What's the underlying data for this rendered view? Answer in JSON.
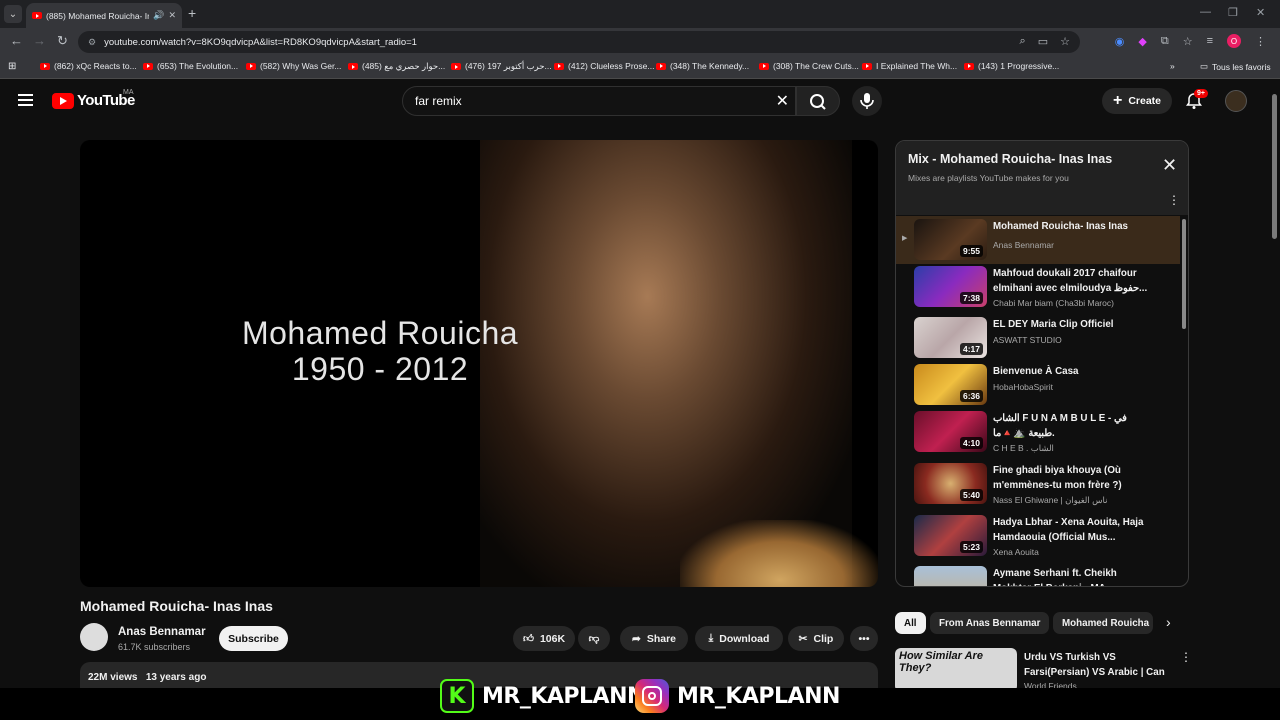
{
  "browser": {
    "tab_title": "(885) Mohamed Rouicha- In",
    "url": "youtube.com/watch?v=8KO9qdvicpA&list=RD8KO9qdvicpA&start_radio=1",
    "profile_initial": "O",
    "bookmarks": [
      "(862) xQc Reacts to...",
      "(653) The Evolution...",
      "(582) Why Was Ger...",
      "(485) حوار حصري مع...",
      "(476) حرب أكتوبر 197...",
      "(412) Clueless Prose...",
      "(348) The Kennedy...",
      "(308) The Crew Cuts...",
      "I Explained The Wh...",
      "(143) 1 Progressive..."
    ],
    "all_bookmarks": "Tous les favoris"
  },
  "youtube": {
    "logo": "YouTube",
    "country": "MA",
    "search_value": "far remix",
    "create_label": "Create",
    "notif_badge": "9+"
  },
  "video": {
    "overlay_line1": "Mohamed Rouicha",
    "overlay_line2": "1950 - 2012",
    "title": "Mohamed Rouicha- Inas Inas",
    "channel": "Anas Bennamar",
    "subscribers": "61.7K subscribers",
    "subscribe_label": "Subscribe",
    "likes": "106K",
    "share_label": "Share",
    "download_label": "Download",
    "clip_label": "Clip",
    "views": "22M views",
    "age": "13 years ago"
  },
  "playlist": {
    "title": "Mix - Mohamed Rouicha- Inas Inas",
    "subtitle": "Mixes are playlists YouTube makes for you",
    "items": [
      {
        "title": "Mohamed Rouicha- Inas Inas",
        "channel": "Anas Bennamar",
        "duration": "9:55"
      },
      {
        "title": "Mahfoud doukali 2017 chaifour elmihani avec elmiloudya حفوظ...",
        "channel": "Chabi Mar biam (Cha3bi Maroc)",
        "duration": "7:38"
      },
      {
        "title": "EL DEY Maria Clip Officiel",
        "channel": "ASWATT STUDIO",
        "duration": "4:17"
      },
      {
        "title": "Bienvenue À Casa",
        "channel": "HobaHobaSpirit",
        "duration": "6:36"
      },
      {
        "title": "الشاب F U N A M B U L E - في طبيعة ⛰️🔺ما.",
        "channel": "C H E B . الشاب",
        "duration": "4:10"
      },
      {
        "title": "Fine ghadi biya khouya (Où m'emmènes-tu mon frère ?)",
        "channel": "Nass El Ghiwane | ناس الغيوان",
        "duration": "5:40"
      },
      {
        "title": "Hadya Lbhar - Xena Aouita, Haja Hamdaouia (Official Mus...",
        "channel": "Xena Aouita",
        "duration": "5:23"
      },
      {
        "title": "Aymane Serhani ft. Cheikh Mokhtar El Berkani - MA",
        "channel": "",
        "duration": ""
      }
    ]
  },
  "chips": [
    "All",
    "From Anas Bennamar",
    "Mohamed Rouicha"
  ],
  "recommendation": {
    "thumb_text": "How Similar Are They?",
    "title": "Urdu VS Turkish VS Farsi(Persian) VS Arabic | Can ...",
    "channel": "World Friends"
  },
  "overlay": {
    "kick_handle": "MR_KAPLANN",
    "insta_handle": "MR_KAPLANN"
  }
}
